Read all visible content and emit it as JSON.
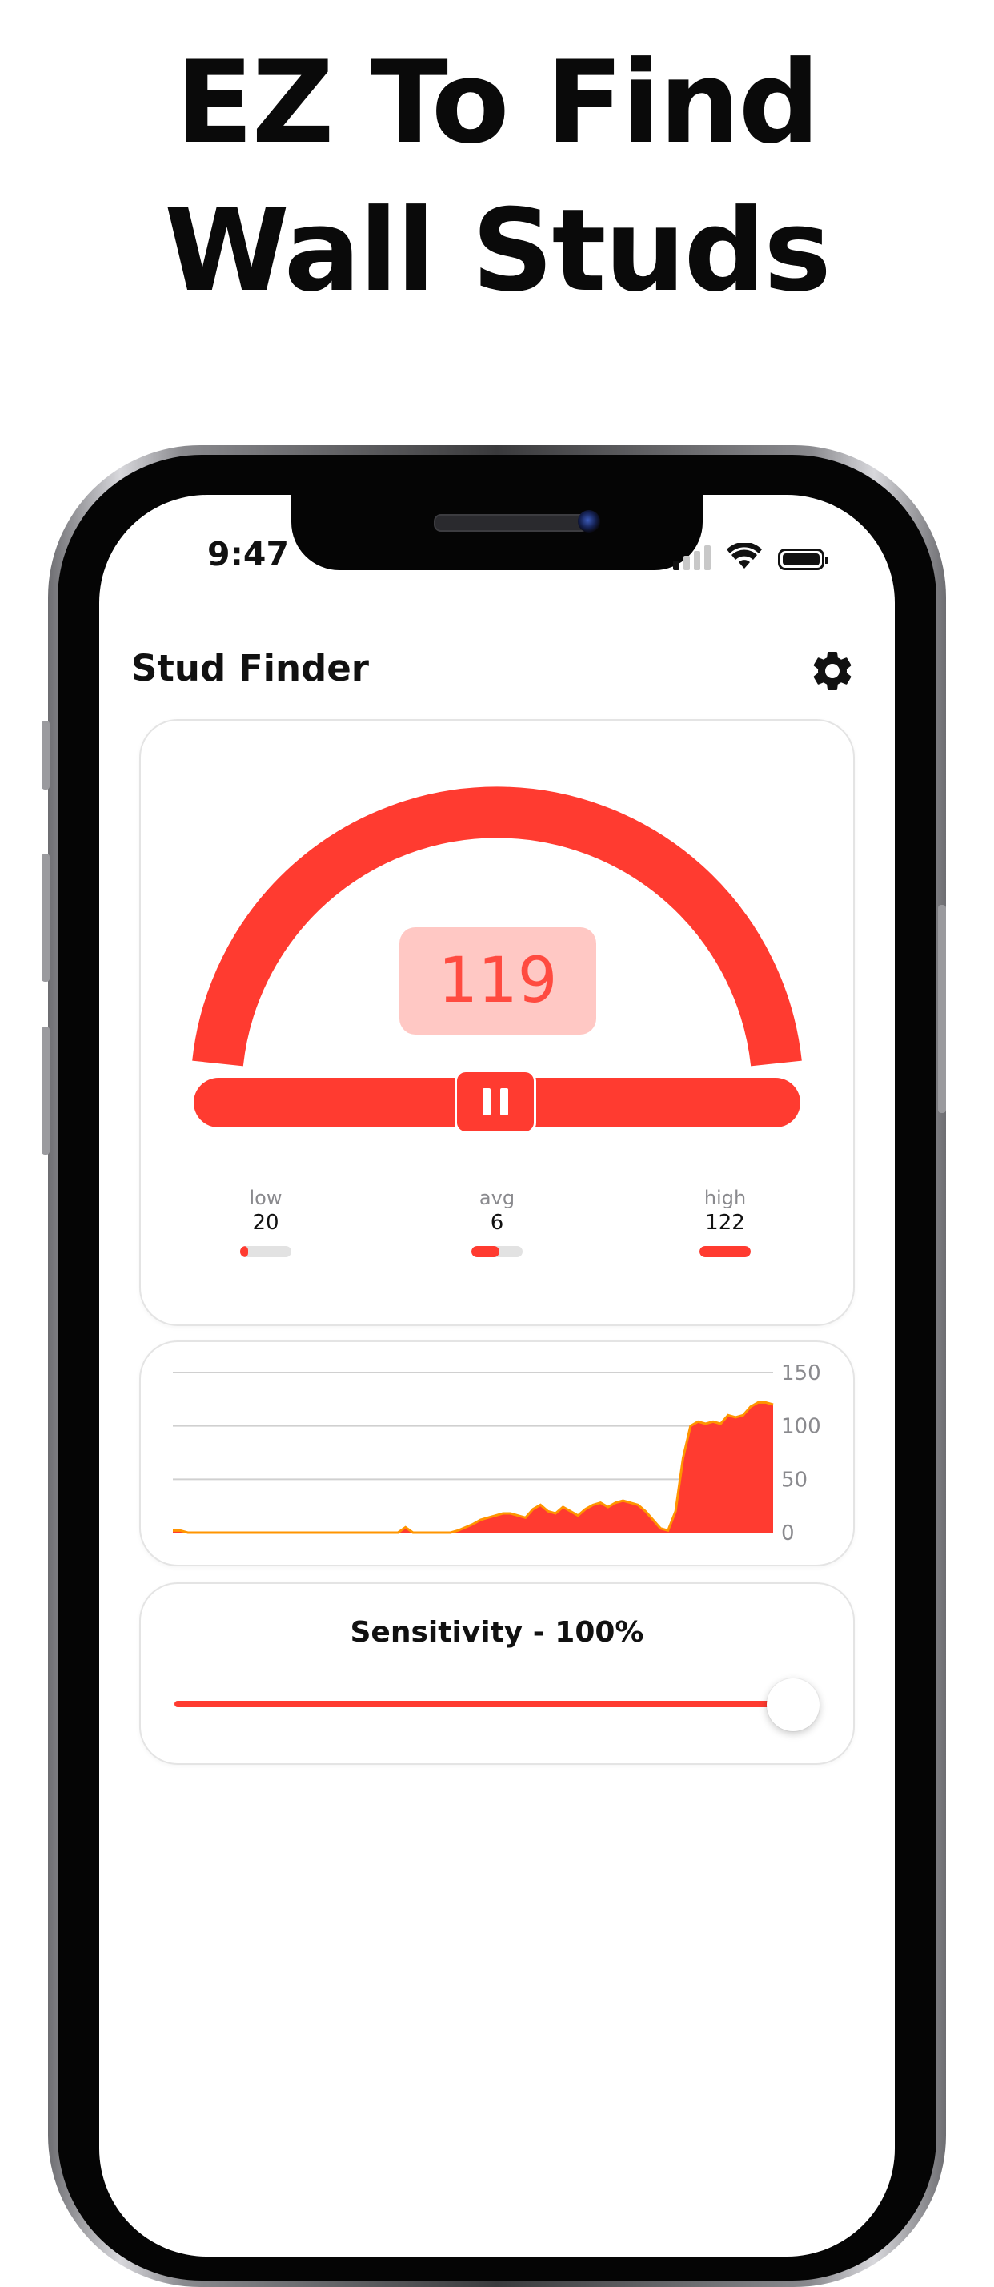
{
  "headline": {
    "line1": "EZ To Find",
    "line2": "Wall Studs"
  },
  "status_bar": {
    "time": "9:47",
    "signal_bars_on": 1,
    "signal_bars_total": 4,
    "wifi": "wifi-icon",
    "battery": "battery-full-icon"
  },
  "app": {
    "title": "Stud Finder",
    "settings_icon": "gear-icon"
  },
  "gauge": {
    "reading": "119",
    "pause_icon": "pause-icon",
    "accent_color": "#ff3b30",
    "reading_bg": "#ffc8c4",
    "stats": [
      {
        "label": "low",
        "value": "20",
        "level": 0.15
      },
      {
        "label": "avg",
        "value": "6",
        "level": 0.55
      },
      {
        "label": "high",
        "value": "122",
        "level": 1.0
      }
    ]
  },
  "chart_data": {
    "type": "area",
    "title": "",
    "xlabel": "",
    "ylabel": "",
    "y_ticks": [
      "150",
      "100",
      "50",
      "0"
    ],
    "ylim": [
      0,
      150
    ],
    "grid": true,
    "y_axis_side": "right",
    "colors": {
      "fill": "#ff3b30",
      "stroke": "#ff9500"
    },
    "x": [
      0,
      1,
      2,
      3,
      4,
      5,
      6,
      7,
      8,
      9,
      10,
      11,
      12,
      13,
      14,
      15,
      16,
      17,
      18,
      19,
      20,
      21,
      22,
      23,
      24,
      25,
      26,
      27,
      28,
      29,
      30,
      31,
      32,
      33,
      34,
      35,
      36,
      37,
      38,
      39,
      40,
      41,
      42,
      43,
      44,
      45,
      46,
      47,
      48,
      49,
      50,
      51,
      52,
      53,
      54,
      55,
      56,
      57,
      58,
      59,
      60,
      61,
      62,
      63,
      64,
      65,
      66,
      67,
      68,
      69,
      70,
      71,
      72,
      73,
      74,
      75,
      76,
      77,
      78,
      79,
      80
    ],
    "values": [
      2,
      2,
      0,
      0,
      0,
      0,
      0,
      0,
      0,
      0,
      0,
      0,
      0,
      0,
      0,
      0,
      0,
      0,
      0,
      0,
      0,
      0,
      0,
      0,
      0,
      0,
      0,
      0,
      0,
      0,
      0,
      5,
      0,
      0,
      0,
      0,
      0,
      0,
      2,
      5,
      8,
      12,
      14,
      16,
      18,
      18,
      16,
      14,
      22,
      26,
      20,
      18,
      24,
      20,
      16,
      22,
      26,
      28,
      24,
      28,
      30,
      28,
      26,
      20,
      12,
      4,
      2,
      20,
      70,
      100,
      104,
      102,
      104,
      102,
      110,
      108,
      110,
      118,
      122,
      122,
      120
    ]
  },
  "sensitivity": {
    "label": "Sensitivity - 100%",
    "level": 1.0
  }
}
